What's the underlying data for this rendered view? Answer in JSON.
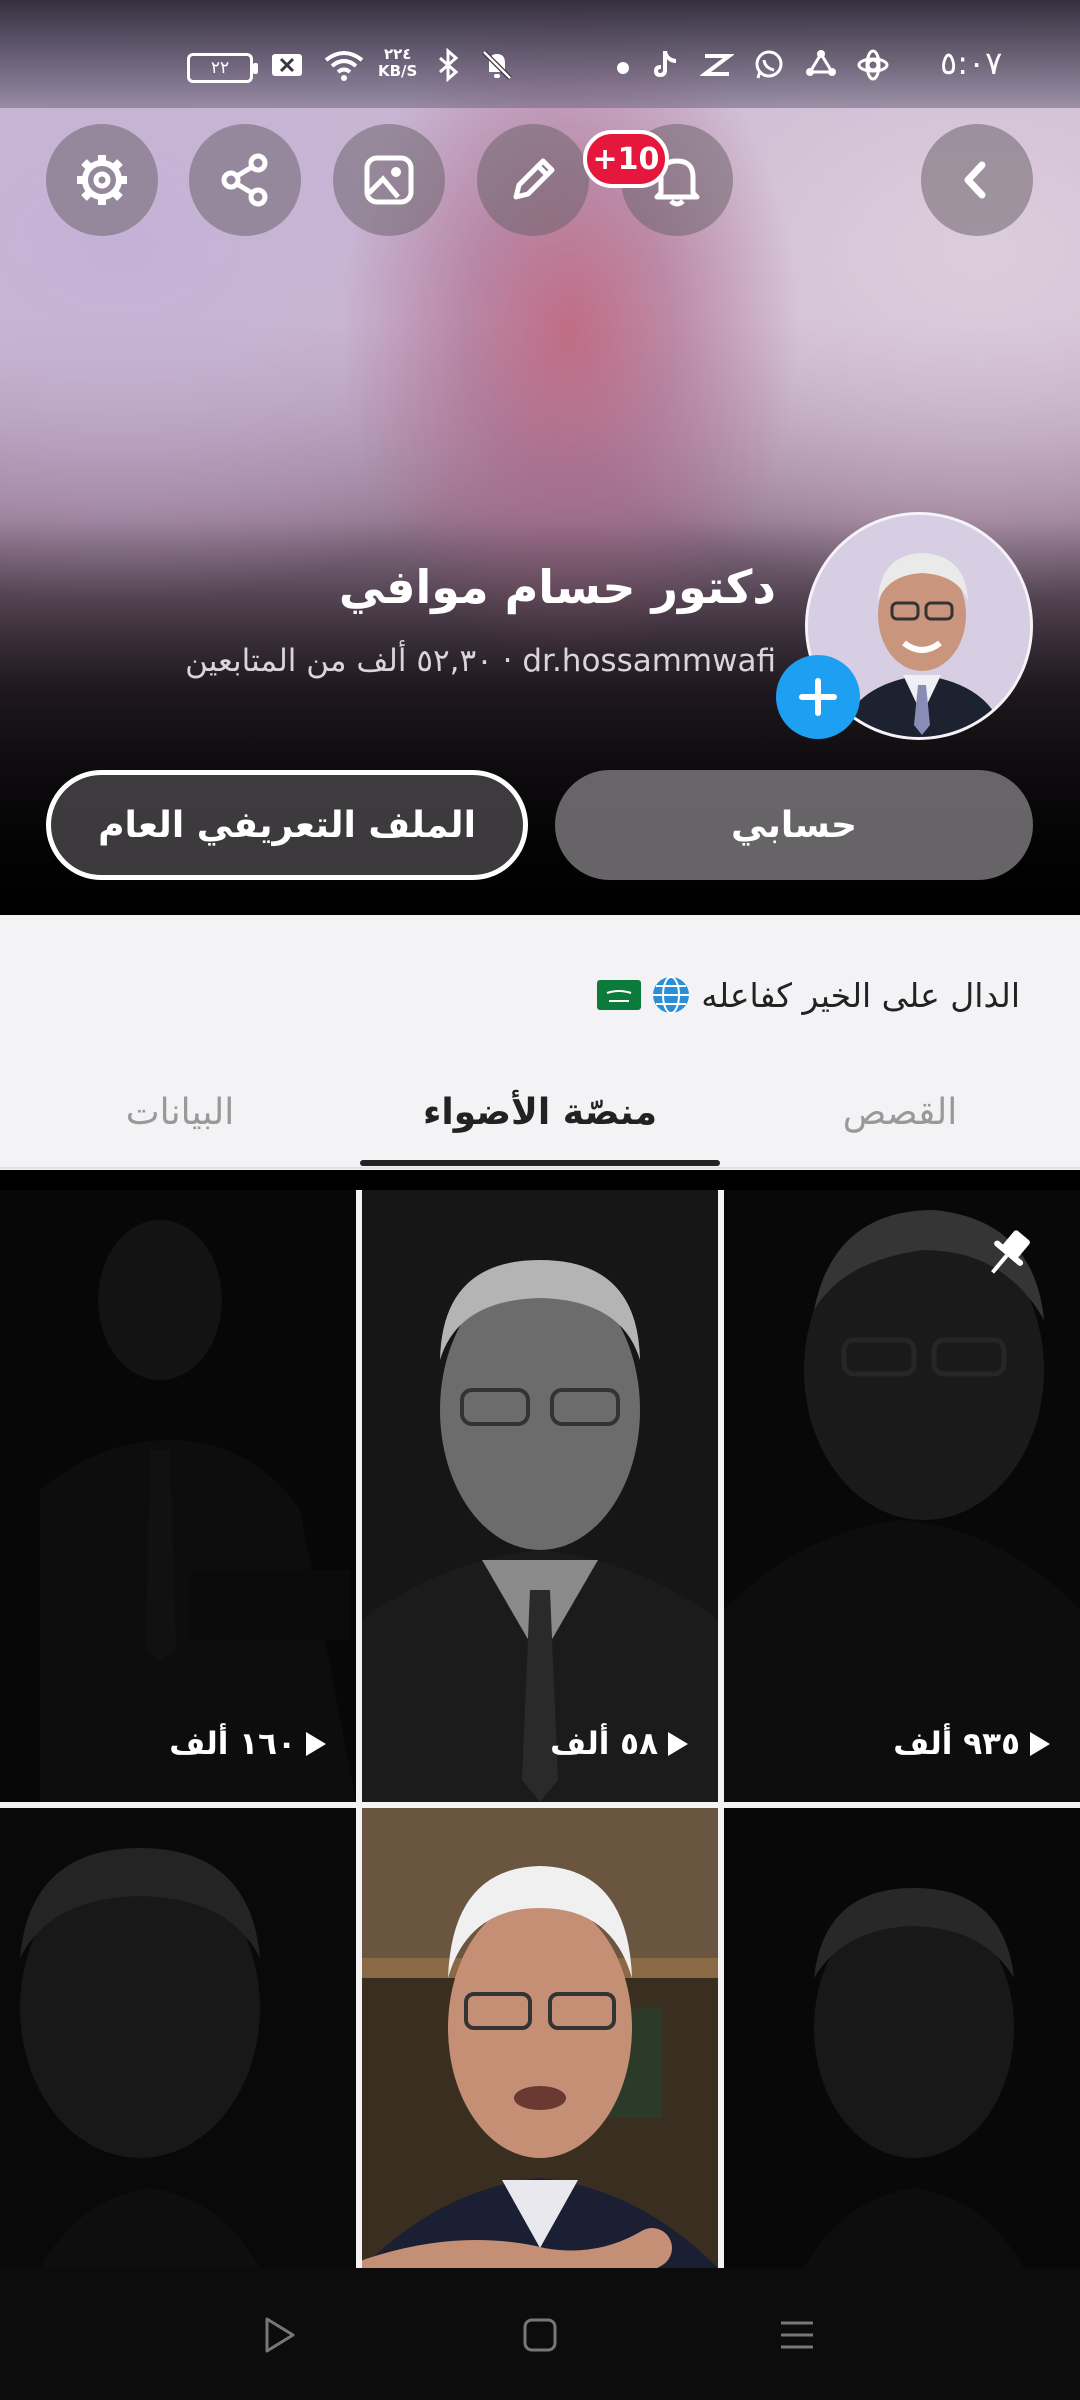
{
  "status_bar": {
    "time": "٥:٠٧",
    "battery": "٢٢",
    "net_speed_value": "٢٢٤",
    "net_speed_unit": "KB/S",
    "icons": [
      "battery-icon",
      "sim-x-icon",
      "wifi-icon",
      "bluetooth-icon",
      "mute-bell-icon",
      "dot-indicator",
      "tiktok-icon",
      "capcut-icon",
      "whatsapp-icon",
      "app-icon",
      "settings-app-icon"
    ]
  },
  "header": {
    "notification_badge": "+10",
    "buttons": [
      "back-button",
      "notifications-button",
      "edit-button",
      "photo-button",
      "share-button",
      "settings-button"
    ]
  },
  "profile": {
    "name": "دكتور حسام موافي",
    "username": "dr.hossammwafi",
    "followers": "٥٢,٣٠ ألف من المتابعين",
    "meta_separator": "·"
  },
  "actions": {
    "account_label": "حسابي",
    "public_profile_label": "الملف التعريفي العام"
  },
  "bio": {
    "text": "الدال على الخير كفاعله",
    "icons": [
      "globe-icon",
      "saudi-flag-icon"
    ]
  },
  "tabs": [
    {
      "label": "القصص",
      "active": false
    },
    {
      "label": "منصّة الأضواء",
      "active": true
    },
    {
      "label": "البيانات",
      "active": false
    }
  ],
  "grid": [
    {
      "views": "٩٣٥ ألف",
      "pinned": true
    },
    {
      "views": "٥٨ ألف",
      "pinned": false
    },
    {
      "views": "١٦٠ ألف",
      "pinned": false
    },
    {
      "views": "",
      "pinned": false
    },
    {
      "views": "",
      "pinned": false
    },
    {
      "views": "",
      "pinned": false
    }
  ],
  "nav_bar": [
    "back-nav-button",
    "home-nav-button",
    "recents-nav-button"
  ]
}
